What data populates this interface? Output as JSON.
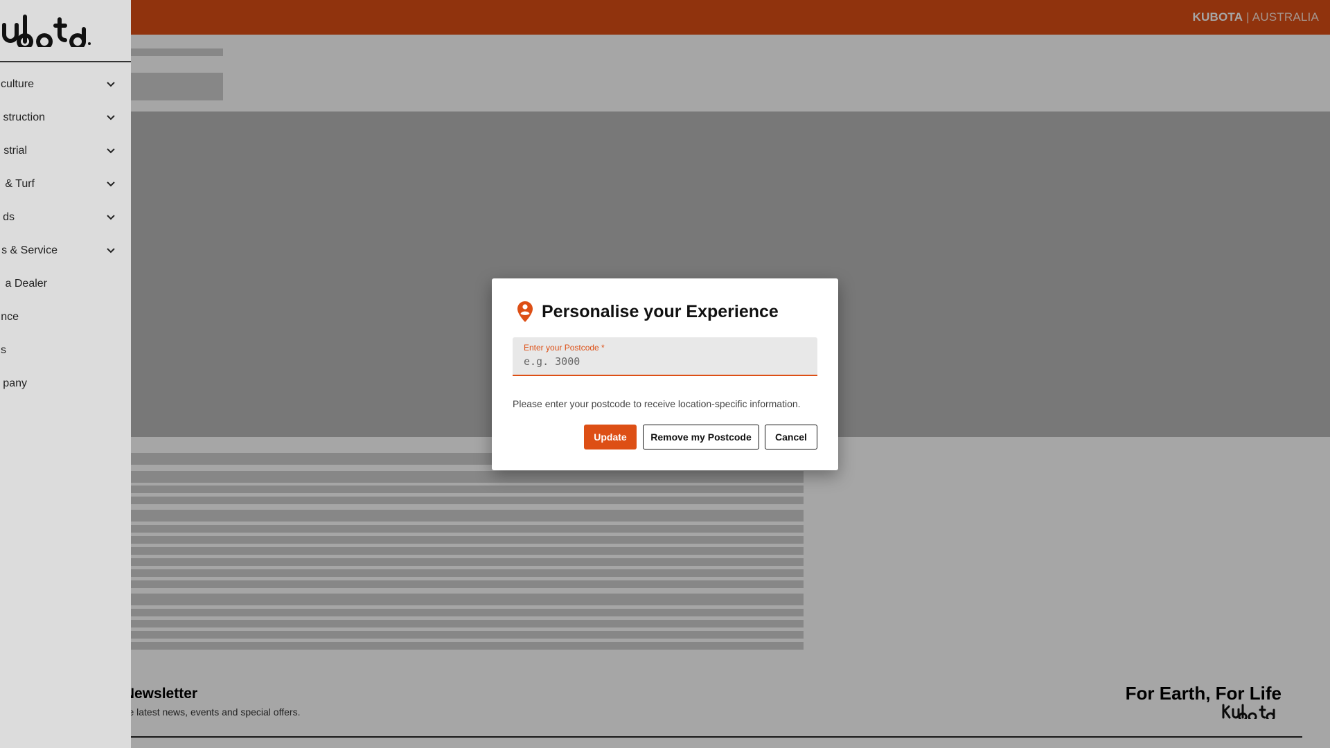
{
  "header": {
    "brand": "KUBOTA",
    "separator": " | ",
    "country": "AUSTRALIA"
  },
  "sidebar": {
    "logo": "kubota",
    "items": [
      {
        "label": "culture",
        "has_chevron": true
      },
      {
        "label": "struction",
        "has_chevron": true
      },
      {
        "label": "strial",
        "has_chevron": true
      },
      {
        "label": "& Turf",
        "has_chevron": true
      },
      {
        "label": "ds",
        "has_chevron": true
      },
      {
        "label": "s & Service",
        "has_chevron": true
      },
      {
        "label": "a Dealer",
        "has_chevron": false
      },
      {
        "label": "nce",
        "has_chevron": false
      },
      {
        "label": "s",
        "has_chevron": false
      },
      {
        "label": "pany",
        "has_chevron": false
      }
    ]
  },
  "modal": {
    "title": "Personalise your Experience",
    "icon": "location-pin-icon",
    "field_label": "Enter your Postcode *",
    "field_placeholder": "e.g. 3000",
    "field_value": "",
    "helper": "Please enter your postcode to receive location-specific information.",
    "update_label": "Update",
    "remove_label": "Remove my Postcode",
    "cancel_label": "Cancel"
  },
  "footer": {
    "newsletter_title": "ur Newsletter",
    "newsletter_sub": "ow the latest news, events and special offers.",
    "tagline": "For Earth, For Life",
    "logo": "kubota"
  },
  "colors": {
    "accent": "#dd4f15",
    "overlay": "rgba(0,0,0,0.35)",
    "skeleton": "#cfcfcf"
  }
}
